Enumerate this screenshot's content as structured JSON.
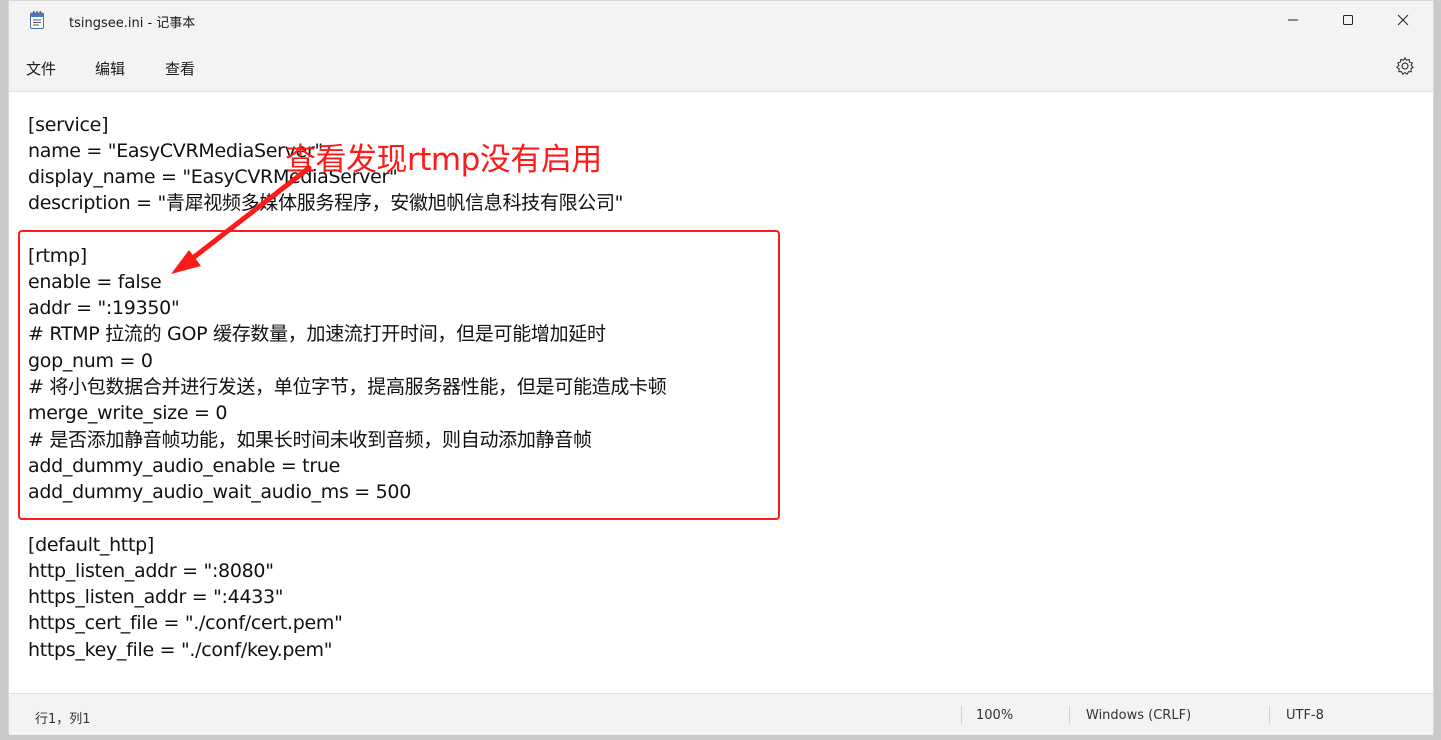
{
  "window": {
    "title": "tsingsee.ini - 记事本",
    "icon": "notepad-icon",
    "controls": [
      "minimize-icon",
      "maximize-icon",
      "close-icon"
    ]
  },
  "menu": {
    "items": [
      "文件",
      "编辑",
      "查看"
    ],
    "settings_icon": "gear-icon"
  },
  "editor": {
    "lines": [
      "[service]",
      "name = \"EasyCVRMediaServer\"",
      "display_name = \"EasyCVRMediaServer\"",
      "description = \"青犀视频多媒体服务程序，安徽旭帆信息科技有限公司\"",
      "",
      "[rtmp]",
      "enable = false",
      "addr = \":19350\"",
      "# RTMP 拉流的 GOP 缓存数量，加速流打开时间，但是可能增加延时",
      "gop_num = 0",
      "# 将小包数据合并进行发送，单位字节，提高服务器性能，但是可能造成卡顿",
      "merge_write_size = 0",
      "# 是否添加静音帧功能，如果长时间未收到音频，则自动添加静音帧",
      "add_dummy_audio_enable = true",
      "add_dummy_audio_wait_audio_ms = 500",
      "",
      "[default_http]",
      "http_listen_addr = \":8080\"",
      "https_listen_addr = \":4433\"",
      "https_cert_file = \"./conf/cert.pem\"",
      "https_key_file = \"./conf/key.pem\""
    ]
  },
  "annotation": {
    "text": "查看发现rtmp没有启用",
    "color": "#ff1a1a"
  },
  "status": {
    "position": "行1，列1",
    "zoom": "100%",
    "line_ending": "Windows (CRLF)",
    "encoding": "UTF-8"
  }
}
